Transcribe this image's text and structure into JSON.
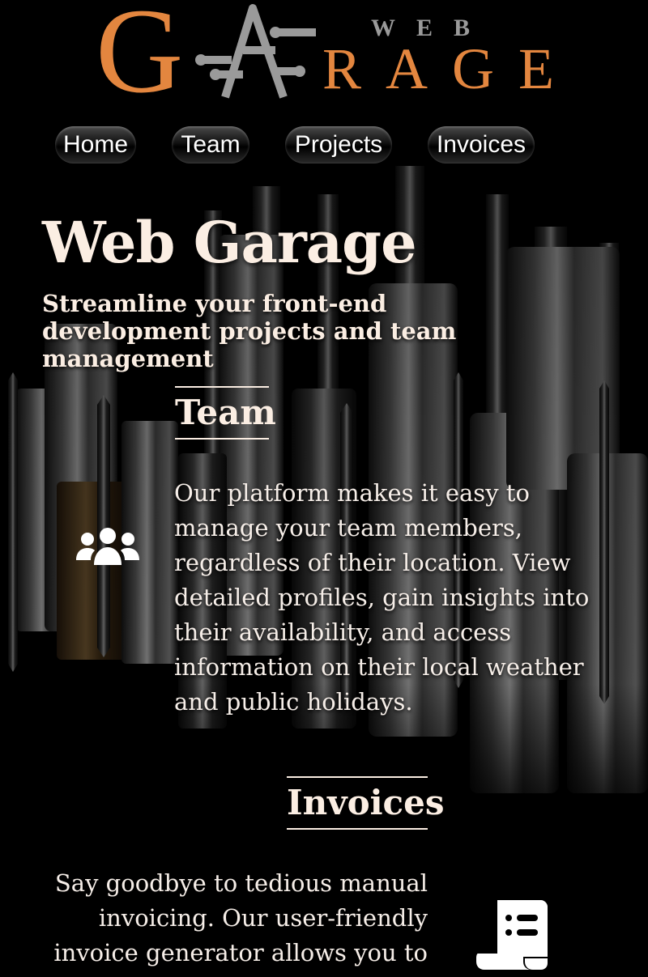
{
  "logo": {
    "letter_g": "G",
    "word_web": "WEB",
    "word_rage": "RAGE"
  },
  "nav": {
    "items": [
      {
        "label": "Home"
      },
      {
        "label": "Team"
      },
      {
        "label": "Projects"
      },
      {
        "label": "Invoices"
      }
    ]
  },
  "hero": {
    "title": "Web Garage",
    "subtitle": "Streamline your front-end development projects and team management"
  },
  "sections": {
    "team": {
      "heading": "Team",
      "icon": "users-icon",
      "text": "Our platform makes it easy to manage your team members, regardless of their location. View detailed profiles, gain insights into their availability, and access information on their local weather and public holidays."
    },
    "invoices": {
      "heading": "Invoices",
      "icon": "receipt-icon",
      "text": "Say goodbye to tedious manual invoicing. Our user-friendly invoice generator allows you to"
    }
  },
  "colors": {
    "background": "#000000",
    "brand_orange": "#e3863f",
    "logo_grey": "#9a9a9a",
    "text_cream": "#fbeee3"
  }
}
